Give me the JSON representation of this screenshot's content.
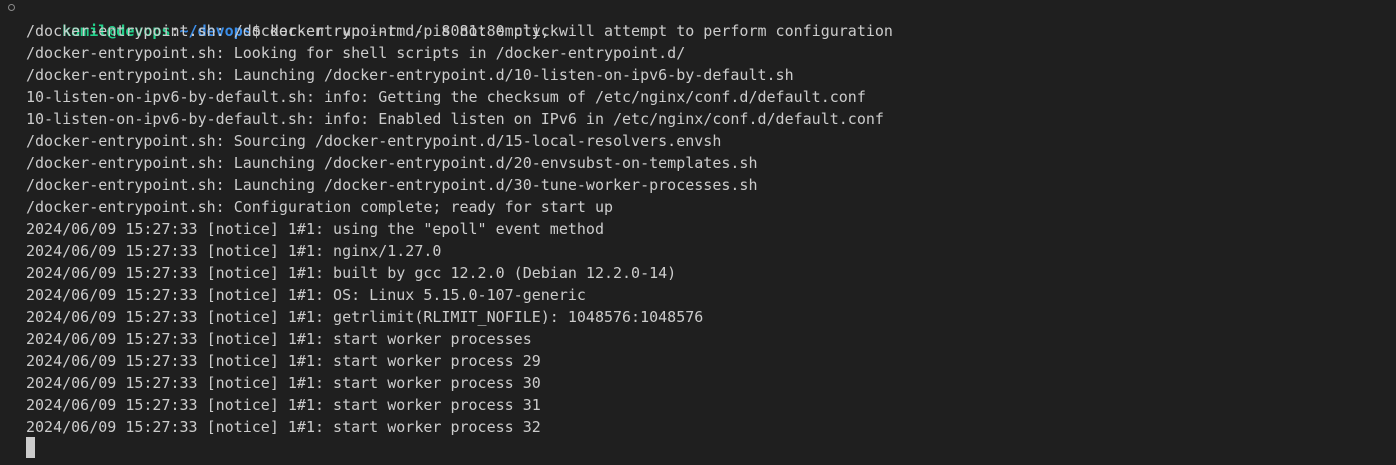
{
  "prompt": {
    "user_host": "kamil@devops",
    "separator": ":",
    "path": "~/devops",
    "symbol": "$ ",
    "command": "docker run --rm -p 8081:80 click"
  },
  "output_lines": [
    "/docker-entrypoint.sh: /docker-entrypoint.d/ is not empty, will attempt to perform configuration",
    "/docker-entrypoint.sh: Looking for shell scripts in /docker-entrypoint.d/",
    "/docker-entrypoint.sh: Launching /docker-entrypoint.d/10-listen-on-ipv6-by-default.sh",
    "10-listen-on-ipv6-by-default.sh: info: Getting the checksum of /etc/nginx/conf.d/default.conf",
    "10-listen-on-ipv6-by-default.sh: info: Enabled listen on IPv6 in /etc/nginx/conf.d/default.conf",
    "/docker-entrypoint.sh: Sourcing /docker-entrypoint.d/15-local-resolvers.envsh",
    "/docker-entrypoint.sh: Launching /docker-entrypoint.d/20-envsubst-on-templates.sh",
    "/docker-entrypoint.sh: Launching /docker-entrypoint.d/30-tune-worker-processes.sh",
    "/docker-entrypoint.sh: Configuration complete; ready for start up",
    "2024/06/09 15:27:33 [notice] 1#1: using the \"epoll\" event method",
    "2024/06/09 15:27:33 [notice] 1#1: nginx/1.27.0",
    "2024/06/09 15:27:33 [notice] 1#1: built by gcc 12.2.0 (Debian 12.2.0-14)",
    "2024/06/09 15:27:33 [notice] 1#1: OS: Linux 5.15.0-107-generic",
    "2024/06/09 15:27:33 [notice] 1#1: getrlimit(RLIMIT_NOFILE): 1048576:1048576",
    "2024/06/09 15:27:33 [notice] 1#1: start worker processes",
    "2024/06/09 15:27:33 [notice] 1#1: start worker process 29",
    "2024/06/09 15:27:33 [notice] 1#1: start worker process 30",
    "2024/06/09 15:27:33 [notice] 1#1: start worker process 31",
    "2024/06/09 15:27:33 [notice] 1#1: start worker process 32"
  ],
  "colors": {
    "background": "#1f1f1f",
    "text": "#cccccc",
    "user_host": "#23d18b",
    "path": "#3b8eea"
  },
  "icons": {
    "prompt_marker": "circle-outline-icon",
    "cursor": "block-cursor"
  }
}
